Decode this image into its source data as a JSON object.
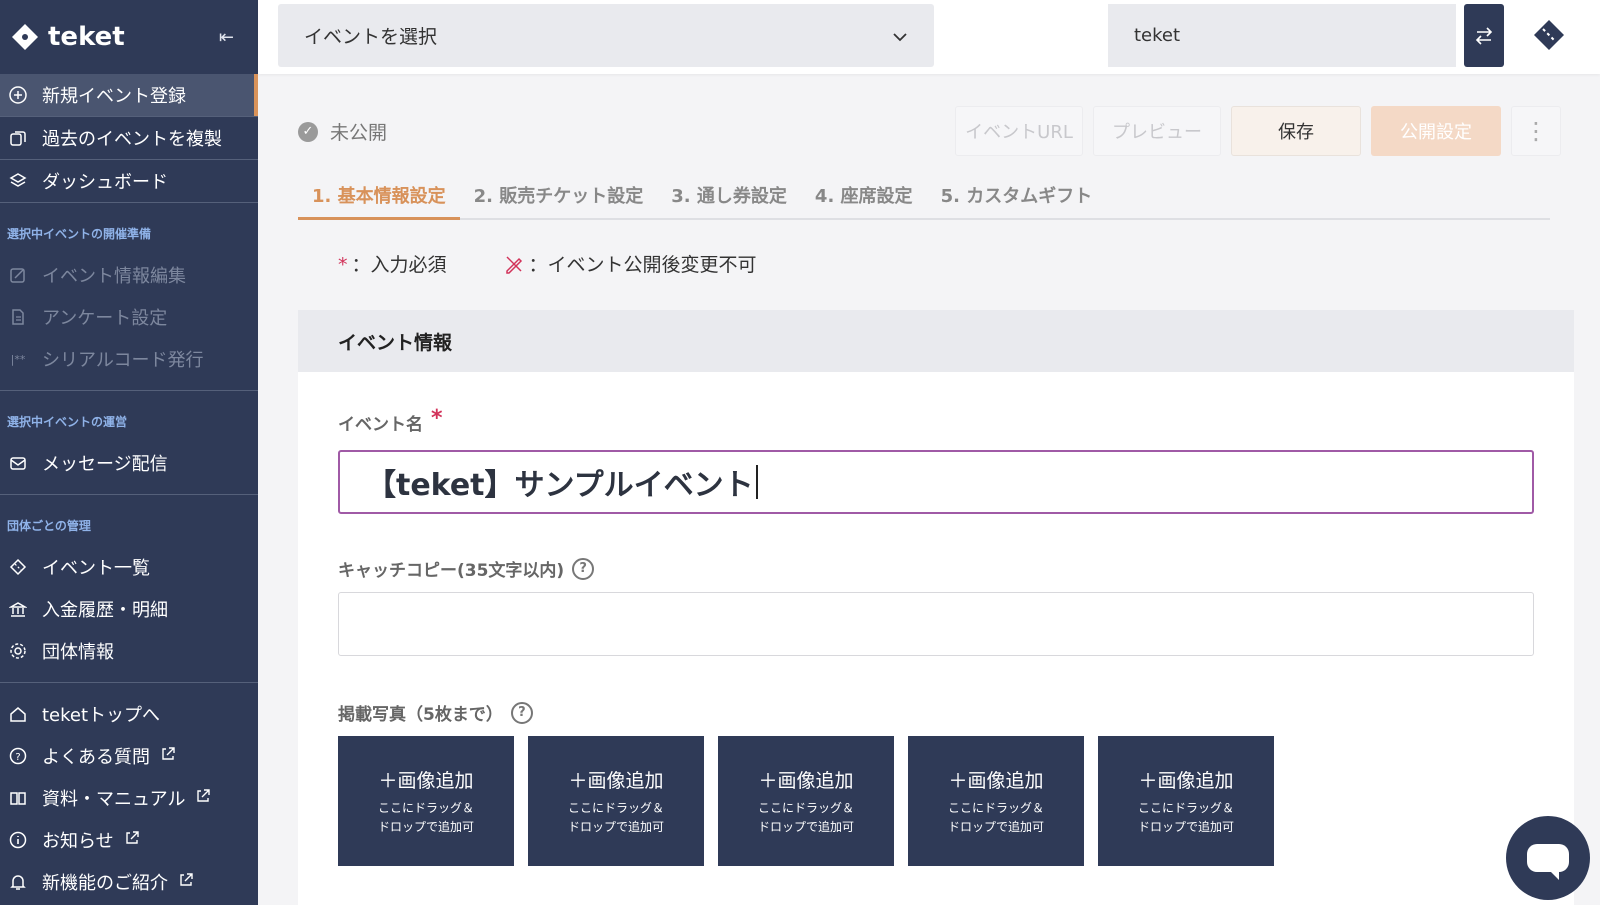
{
  "sidebar": {
    "brand": "teket",
    "collapse_glyph": "⇤",
    "top_items": [
      {
        "label": "新規イベント登録",
        "icon": "plus-circle-icon"
      },
      {
        "label": "過去のイベントを複製",
        "icon": "copy-icon"
      },
      {
        "label": "ダッシュボード",
        "icon": "layers-icon"
      }
    ],
    "section_prep": "選択中イベントの開催準備",
    "prep_items": [
      {
        "label": "イベント情報編集",
        "icon": "edit-icon"
      },
      {
        "label": "アンケート設定",
        "icon": "document-icon"
      },
      {
        "label": "シリアルコード発行",
        "icon": "serial-icon"
      }
    ],
    "section_ops": "選択中イベントの運営",
    "ops_items": [
      {
        "label": "メッセージ配信",
        "icon": "mail-icon"
      }
    ],
    "section_org": "団体ごとの管理",
    "org_items": [
      {
        "label": "イベント一覧",
        "icon": "ticket-icon"
      },
      {
        "label": "入金履歴・明細",
        "icon": "bank-icon"
      },
      {
        "label": "団体情報",
        "icon": "gear-icon"
      }
    ],
    "link_items": [
      {
        "label": "teketトップへ",
        "icon": "home-icon"
      },
      {
        "label": "よくある質問",
        "icon": "question-icon"
      },
      {
        "label": "資料・マニュアル",
        "icon": "book-icon"
      },
      {
        "label": "お知らせ",
        "icon": "info-icon"
      },
      {
        "label": "新機能のご紹介",
        "icon": "bell-icon"
      }
    ]
  },
  "topbar": {
    "event_select": "イベントを選択",
    "org_name": "teket"
  },
  "main": {
    "status": "未公開",
    "actions": {
      "event_url": "イベントURL",
      "preview": "プレビュー",
      "save": "保存",
      "publish": "公開設定",
      "more": "⋮"
    },
    "tabs": [
      "1. 基本情報設定",
      "2. 販売チケット設定",
      "3. 通し券設定",
      "4. 座席設定",
      "5. カスタムギフト"
    ],
    "legend": {
      "required_mark": "*",
      "required": "：入力必須",
      "locked": "：イベント公開後変更不可"
    },
    "card": {
      "title": "イベント情報",
      "event_name_label": "イベント名",
      "event_name_value": "【teket】サンプルイベント",
      "catch_label": "キャッチコピー(35文字以内)",
      "photos_label": "掲載写真（5枚まで）",
      "photo_slot": {
        "title": "＋画像追加",
        "line1": "ここにドラッグ＆",
        "line2": "ドロップで追加可"
      }
    }
  },
  "colors": {
    "sidebar": "#2f3a57",
    "accent": "#d8925a",
    "required": "#d2335a",
    "focus_border": "#a05aa6"
  }
}
